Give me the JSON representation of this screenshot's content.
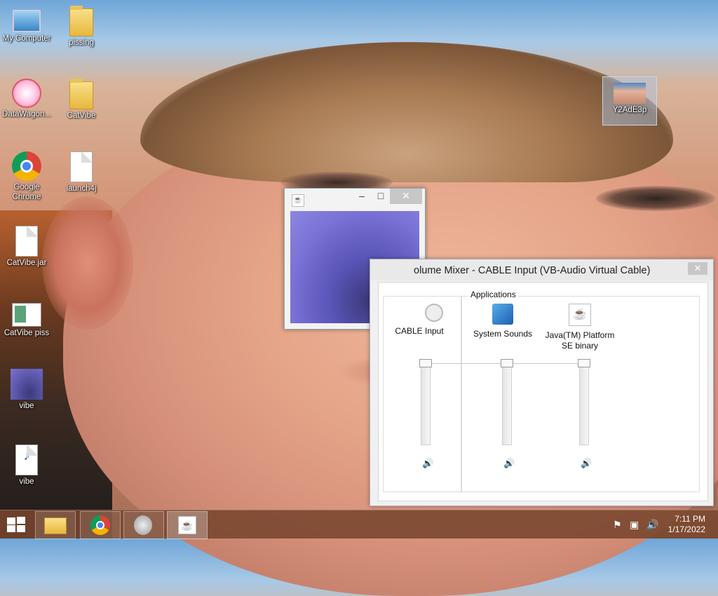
{
  "desktop": {
    "icons": [
      {
        "label": "My Computer",
        "icon": "computer-icon"
      },
      {
        "label": "pissing",
        "icon": "folder-icon"
      },
      {
        "label": "DataWagon...",
        "icon": "datawagon-icon"
      },
      {
        "label": "CatVibe",
        "icon": "folder-icon"
      },
      {
        "label": "Google Chrome",
        "icon": "chrome-icon"
      },
      {
        "label": "launch4j",
        "icon": "file-icon"
      },
      {
        "label": "CatVibe.jar",
        "icon": "file-icon"
      },
      {
        "label": "CatVibe piss",
        "icon": "app-window-icon"
      },
      {
        "label": "vibe",
        "icon": "image-thumbnail-icon"
      },
      {
        "label": "vibe",
        "icon": "mp3-icon"
      },
      {
        "label": "Y2AdE3p",
        "icon": "image-thumbnail-icon"
      }
    ]
  },
  "java_window": {
    "minimize": "–",
    "maximize": "□",
    "close": "✕"
  },
  "mixer": {
    "title": "Volume Mixer - CABLE Input (VB-Audio Virtual Cable)",
    "title_visible": "olume Mixer - CABLE Input (VB-Audio Virtual Cable)",
    "close": "✕",
    "group_label": "Applications",
    "channels": [
      {
        "name": "CABLE Input",
        "icon": "speaker-device-icon",
        "level": 1.0
      },
      {
        "name": "System Sounds",
        "icon": "system-sounds-icon",
        "level": 1.0
      },
      {
        "name": "Java(TM) Platform SE binary",
        "icon": "java-icon",
        "level": 1.0
      }
    ],
    "mute_glyph": "🔊"
  },
  "taskbar": {
    "apps": [
      {
        "name": "file-explorer",
        "icon": "file-explorer-icon"
      },
      {
        "name": "google-chrome",
        "icon": "chrome-icon"
      },
      {
        "name": "volume",
        "icon": "speaker-icon"
      },
      {
        "name": "java",
        "icon": "java-icon"
      }
    ],
    "time": "7:11 PM",
    "date": "1/17/2022"
  },
  "colors": {
    "taskbar": "#7a4a32",
    "accent": "#1a5fb4"
  }
}
